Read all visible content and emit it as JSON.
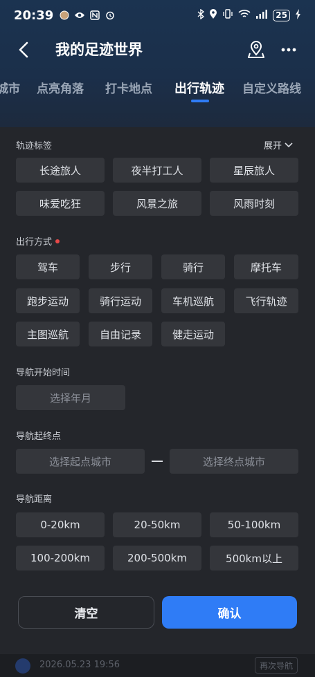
{
  "status_bar": {
    "time": "20:39",
    "battery": "25"
  },
  "header": {
    "title": "我的足迹世界"
  },
  "tabs": [
    {
      "label": "城市"
    },
    {
      "label": "点亮角落"
    },
    {
      "label": "打卡地点"
    },
    {
      "label": "出行轨迹",
      "active": true
    },
    {
      "label": "自定义路线"
    }
  ],
  "filters": {
    "tags_label": "轨迹标签",
    "expand_label": "展开",
    "tags": [
      "长途旅人",
      "夜半打工人",
      "星辰旅人",
      "味爱吃狂",
      "风景之旅",
      "风雨时刻"
    ],
    "mode_label": "出行方式",
    "modes": [
      "驾车",
      "步行",
      "骑行",
      "摩托车",
      "跑步运动",
      "骑行运动",
      "车机巡航",
      "飞行轨迹",
      "主图巡航",
      "自由记录",
      "健走运动"
    ],
    "start_time_label": "导航开始时间",
    "start_time_placeholder": "选择年月",
    "endpoints_label": "导航起终点",
    "origin_placeholder": "选择起点城市",
    "destination_placeholder": "选择终点城市",
    "distance_label": "导航距离",
    "distances": [
      "0-20km",
      "20-50km",
      "50-100km",
      "100-200km",
      "200-500km",
      "500km以上"
    ]
  },
  "actions": {
    "clear_label": "清空",
    "confirm_label": "确认"
  },
  "background_record": {
    "time": "2026.05.23 19:56",
    "renav_label": "再次导航"
  },
  "colors": {
    "accent": "#2f7cf6",
    "required_dot": "#e84848",
    "chip_bg": "#34363b",
    "sheet_bg": "#24262b"
  }
}
